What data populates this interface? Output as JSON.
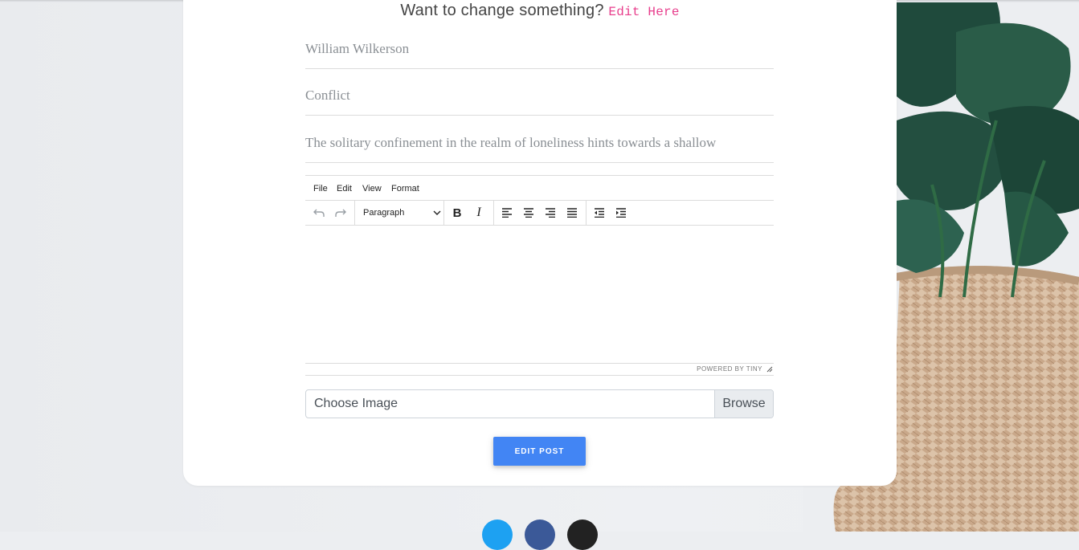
{
  "header": {
    "prompt": "Want to change something?",
    "edit_link": "Edit Here"
  },
  "form": {
    "author": "William Wilkerson",
    "title": "Conflict",
    "description": "The solitary confinement in the realm of loneliness hints towards a shallow"
  },
  "editor": {
    "menu": [
      "File",
      "Edit",
      "View",
      "Format"
    ],
    "block_format": "Paragraph",
    "powered_by": "POWERED BY TINY"
  },
  "upload": {
    "label": "Choose Image",
    "browse": "Browse"
  },
  "submit_label": "EDIT POST",
  "social": [
    {
      "name": "twitter-icon",
      "color": "#1da1f2"
    },
    {
      "name": "facebook-icon",
      "color": "#3b5998"
    },
    {
      "name": "pinterest-icon",
      "color": "#222222"
    }
  ]
}
